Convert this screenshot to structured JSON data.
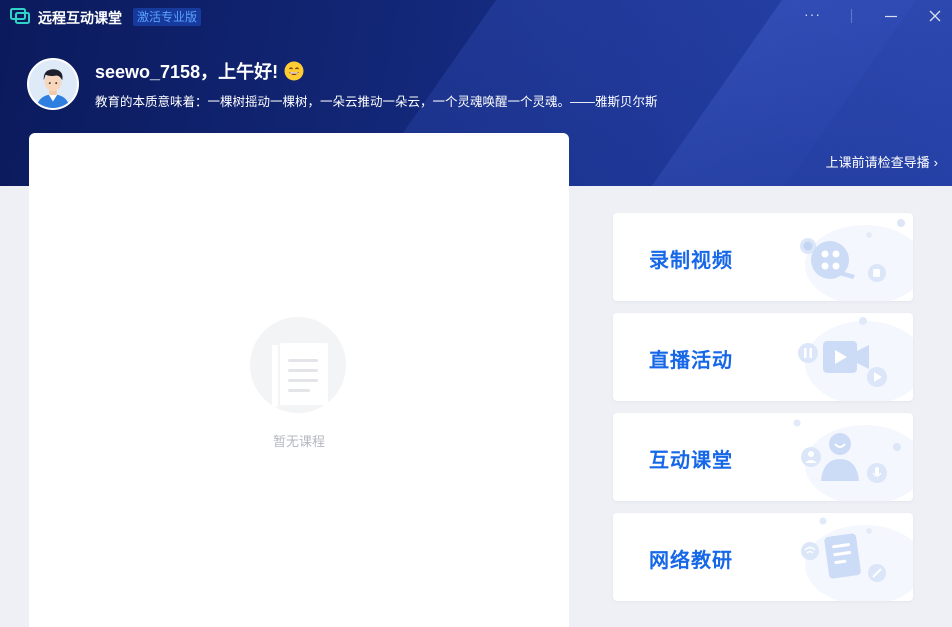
{
  "window": {
    "title": "远程互动课堂",
    "edition_badge": "激活专业版",
    "more_label": "···"
  },
  "greeting": {
    "text": "seewo_7158，上午好!",
    "quote": "教育的本质意味着：一棵树摇动一棵树，一朵云推动一朵云，一个灵魂唤醒一个灵魂。——雅斯贝尔斯"
  },
  "guide": {
    "label": "上课前请检查导播",
    "chevron": "›"
  },
  "courses": {
    "empty_text": "暂无课程"
  },
  "actions": [
    {
      "label": "录制视频",
      "icon": "film-reel-icon"
    },
    {
      "label": "直播活动",
      "icon": "video-camera-icon"
    },
    {
      "label": "互动课堂",
      "icon": "user-chat-icon"
    },
    {
      "label": "网络教研",
      "icon": "document-icon"
    }
  ],
  "colors": {
    "hero_dark": "#0b1a5c",
    "hero_light": "#243fa4",
    "accent": "#1668e8",
    "card_icon": "#cddcf6"
  }
}
